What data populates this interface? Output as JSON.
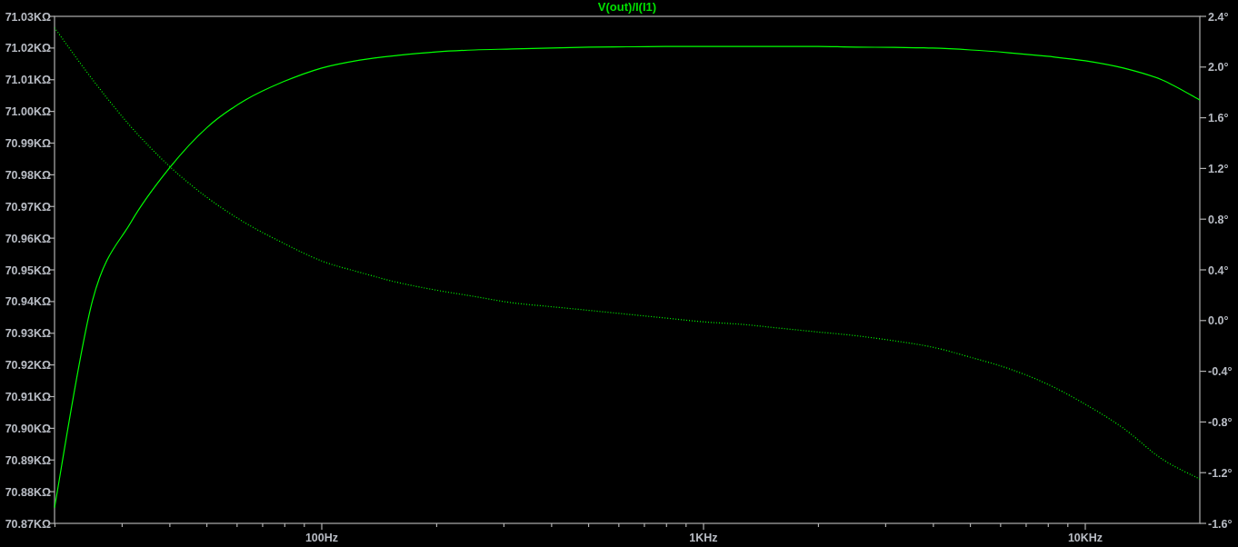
{
  "plot": {
    "magnitude": {
      "chart_data": {
        "type": "line",
        "title": "V(out)/I(I1)",
        "categories": [
          null,
          null,
          null,
          null,
          null,
          null,
          null,
          "100Hz",
          null,
          null,
          null,
          null,
          null,
          null,
          null,
          null,
          null,
          "1KHz",
          null,
          null,
          null,
          null,
          null,
          null,
          null,
          null,
          null,
          "10KHz",
          null,
          null,
          null
        ],
        "ylim": [
          70.87,
          71.03
        ],
        "yticks": [
          {
            "value": 71.03,
            "label": "71.03KΩ"
          },
          {
            "value": 71.02,
            "label": "71.02KΩ"
          },
          {
            "value": 71.01,
            "label": "71.01KΩ"
          },
          {
            "value": 71.0,
            "label": "71.00KΩ"
          },
          {
            "value": 70.99,
            "label": "70.99KΩ"
          },
          {
            "value": 70.98,
            "label": "70.98KΩ"
          },
          {
            "value": 70.97,
            "label": "70.97KΩ"
          },
          {
            "value": 70.96,
            "label": "70.96KΩ"
          },
          {
            "value": 70.95,
            "label": "70.95KΩ"
          },
          {
            "value": 70.94,
            "label": "70.94KΩ"
          },
          {
            "value": 70.93,
            "label": "70.93KΩ"
          },
          {
            "value": 70.92,
            "label": "70.92KΩ"
          },
          {
            "value": 70.91,
            "label": "70.91KΩ"
          },
          {
            "value": 70.9,
            "label": "70.90KΩ"
          },
          {
            "value": 70.89,
            "label": "70.89KΩ"
          },
          {
            "value": 70.88,
            "label": "70.88KΩ"
          },
          {
            "value": 70.87,
            "label": "70.87KΩ"
          }
        ],
        "series": [
          {
            "color": "#00ff00",
            "line_style": "solid",
            "values": [
              70.875,
              70.9406,
              70.965,
              70.982,
              70.995,
              71.0036,
              71.0094,
              71.0137,
              71.0162,
              71.0177,
              71.0188,
              71.0194,
              71.0197,
              71.02,
              71.0203,
              71.0204,
              71.0205,
              71.0205,
              71.0205,
              71.0205,
              71.0205,
              71.0203,
              71.0202,
              71.02,
              71.0194,
              71.0185,
              71.0174,
              71.016,
              71.0137,
              71.01,
              71.0036
            ]
          }
        ]
      }
    },
    "phase": {
      "chart_data": {
        "type": "line",
        "ylim": [
          -1.6,
          2.4
        ],
        "yticks": [
          {
            "value": 2.4,
            "label": "2.4°"
          },
          {
            "value": 2.0,
            "label": "2.0°"
          },
          {
            "value": 1.6,
            "label": "1.6°"
          },
          {
            "value": 1.2,
            "label": "1.2°"
          },
          {
            "value": 0.8,
            "label": "0.8°"
          },
          {
            "value": 0.4,
            "label": "0.4°"
          },
          {
            "value": 0.0,
            "label": "0.0°"
          },
          {
            "value": -0.4,
            "label": "-0.4°"
          },
          {
            "value": -0.8,
            "label": "-0.8°"
          },
          {
            "value": -1.2,
            "label": "-1.2°"
          },
          {
            "value": -1.6,
            "label": "-1.6°"
          }
        ],
        "series": [
          {
            "color": "#00ff00",
            "line_style": "dotted",
            "values": [
              2.31,
              1.9,
              1.53,
              1.22,
              0.97,
              0.77,
              0.61,
              0.47,
              0.38,
              0.3,
              0.24,
              0.19,
              0.14,
              0.11,
              0.08,
              0.05,
              0.02,
              -0.01,
              -0.03,
              -0.06,
              -0.09,
              -0.12,
              -0.16,
              -0.21,
              -0.29,
              -0.38,
              -0.5,
              -0.66,
              -0.85,
              -1.09,
              -1.25
            ]
          }
        ]
      }
    }
  }
}
